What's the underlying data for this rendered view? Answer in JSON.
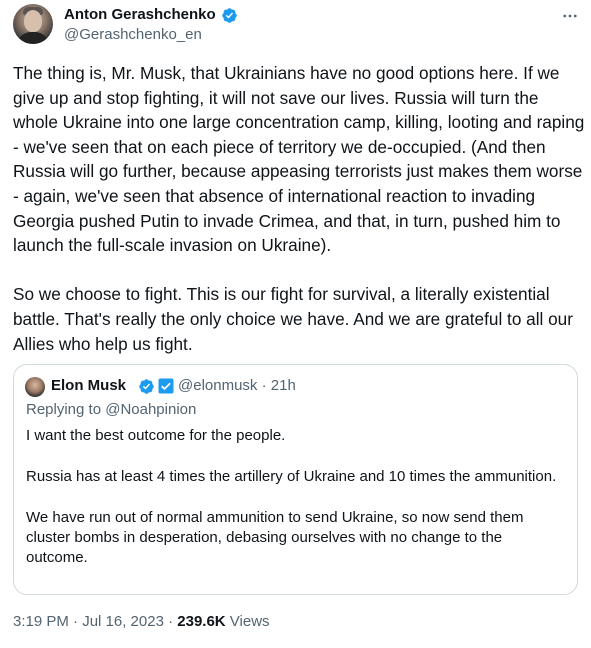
{
  "author": {
    "name": "Anton Gerashchenko",
    "handle": "@Gerashchenko_en",
    "verified": true,
    "verified_color": "#1d9bf0"
  },
  "more_icon": "more-horizontal-icon",
  "tweet": {
    "paragraphs": [
      "The thing is, Mr. Musk, that Ukrainians have no good options here. If we give up and stop fighting, it will not save our lives. Russia will turn the whole Ukraine into one large concentration camp, killing, looting and raping - we've seen that on each piece of territory we de-occupied. (And then Russia will go further, because appeasing terrorists just makes them worse - again, we've seen that absence of international reaction to invading Georgia pushed Putin to invade Crimea, and that, in turn, pushed him to launch the full-scale invasion on Ukraine).",
      "So we choose to fight. This is our fight for survival, a literally existential battle. That's really the only choice we have. And we are grateful to all our Allies who help us fight."
    ]
  },
  "quote": {
    "name": "Elon Musk",
    "verified": true,
    "badge_icon": "government-affiliation-icon",
    "handle_time": "@elonmusk · 21h",
    "replying_to": "Replying to @Noahpinion",
    "paragraphs": [
      "I want the best outcome for the people.",
      "Russia has at least 4 times the artillery of Ukraine and 10 times the ammunition.",
      "We have run out of normal ammunition to send Ukraine, so now send them cluster bombs in desperation, debasing ourselves with no change to the outcome."
    ]
  },
  "meta": {
    "time_date": "3:19 PM · Jul 16, 2023 · ",
    "views_count": "239.6K",
    "views_label": " Views"
  }
}
